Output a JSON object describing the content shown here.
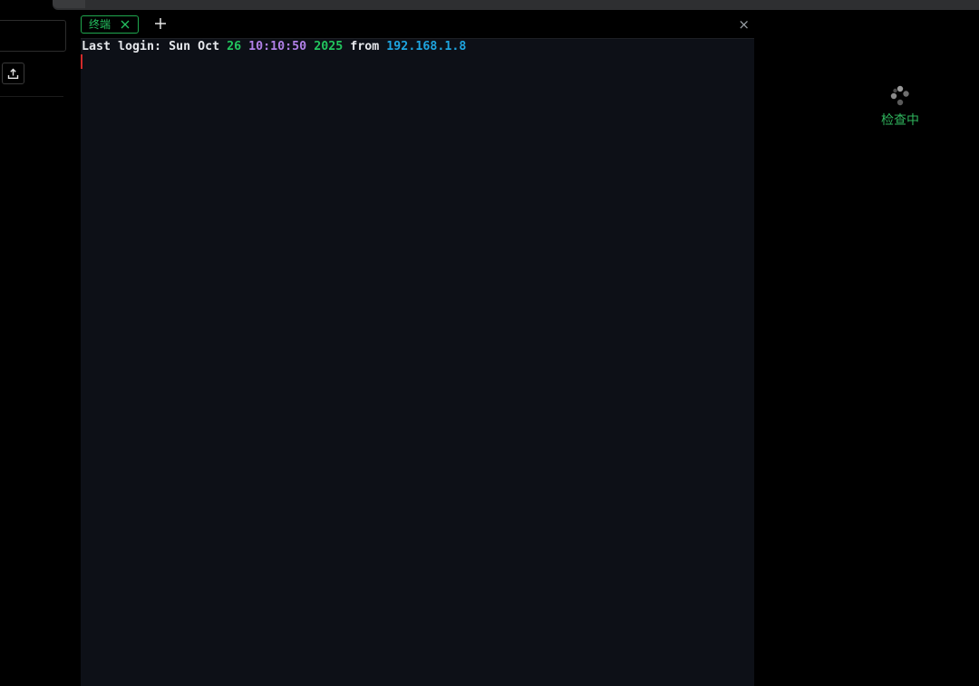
{
  "tabs": [
    {
      "label": "终端",
      "active": true
    }
  ],
  "terminal": {
    "segments": {
      "prefix": "Last login: Sun Oct ",
      "day": "26",
      "time": "10:10:50",
      "year": "2025",
      "from_word": "from",
      "ip": "192.168.1.8"
    }
  },
  "status": {
    "text": "检查中"
  },
  "icons": {
    "upload": "upload-icon",
    "tab_close": "close-icon",
    "tab_add": "plus-icon",
    "panel_close": "close-icon",
    "spinner": "loading-spinner-icon"
  },
  "panel_close_glyph": "×",
  "colors": {
    "accent_green": "#24c160",
    "terminal_bg": "#0d1017",
    "time_purple": "#b180e8",
    "ip_blue": "#1ea5e0",
    "cursor_red": "#d22b2b"
  }
}
